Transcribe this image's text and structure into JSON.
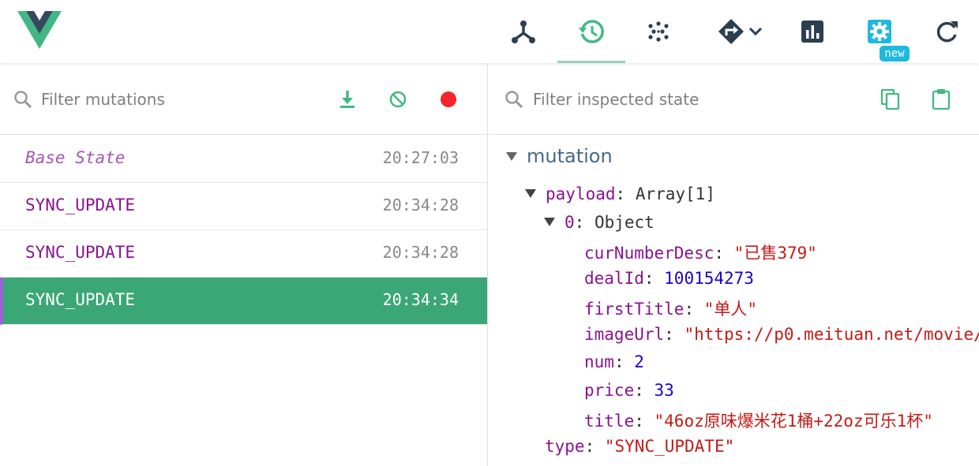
{
  "header": {
    "nav": [
      {
        "name": "components",
        "icon": "component-tree-icon"
      },
      {
        "name": "vuex",
        "icon": "history-icon",
        "active": true
      },
      {
        "name": "events",
        "icon": "events-dots-icon"
      },
      {
        "name": "routing",
        "icon": "routing-sign-icon"
      },
      {
        "name": "performance",
        "icon": "bar-chart-icon"
      },
      {
        "name": "settings",
        "icon": "gear-icon"
      },
      {
        "name": "refresh",
        "icon": "refresh-icon"
      }
    ],
    "new_badge": "new"
  },
  "left": {
    "search_placeholder": "Filter mutations",
    "mutations": [
      {
        "name": "Base State",
        "time": "20:27:03",
        "base": true
      },
      {
        "name": "SYNC_UPDATE",
        "time": "20:34:28"
      },
      {
        "name": "SYNC_UPDATE",
        "time": "20:34:28"
      },
      {
        "name": "SYNC_UPDATE",
        "time": "20:34:34",
        "selected": true
      }
    ]
  },
  "right": {
    "search_placeholder": "Filter inspected state",
    "section": "mutation",
    "payload_key": "payload",
    "payload_value": "Array[1]",
    "item_key": "0",
    "item_value": "Object",
    "fields": [
      {
        "key": "curNumberDesc",
        "value": "\"已售379\"",
        "kind": "str"
      },
      {
        "key": "dealId",
        "value": "100154273",
        "kind": "num"
      },
      {
        "key": "firstTitle",
        "value": "\"单人\"",
        "kind": "str"
      },
      {
        "key": "imageUrl",
        "value": "\"https://p0.meituan.net/movie/",
        "kind": "str"
      },
      {
        "key": "num",
        "value": "2",
        "kind": "num"
      },
      {
        "key": "price",
        "value": "33",
        "kind": "num"
      },
      {
        "key": "title",
        "value": "\"46oz原味爆米花1桶+22oz可乐1杯\"",
        "kind": "str"
      }
    ],
    "type_key": "type",
    "type_value": "\"SYNC_UPDATE\""
  },
  "colors": {
    "accent": "#42b983",
    "selected_row": "#3ba776",
    "record": "#f4262c",
    "badge": "#1fb8e0"
  }
}
